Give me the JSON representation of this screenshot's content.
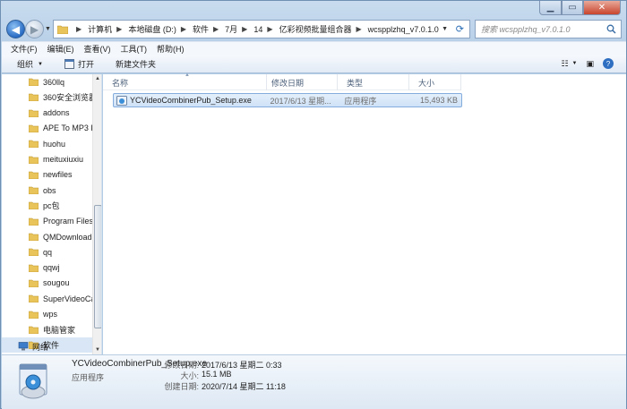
{
  "window": {
    "caption_buttons": {
      "minimize": "▁",
      "maximize": "▭",
      "close": "✕"
    }
  },
  "address_bar": {
    "breadcrumbs": [
      "计算机",
      "本地磁盘 (D:)",
      "软件",
      "7月",
      "14",
      "亿彩视频批量组合器",
      "wcspplzhq_v7.0.1.0"
    ],
    "search_placeholder": "搜索 wcspplzhq_v7.0.1.0"
  },
  "menubar": {
    "items": [
      "文件(F)",
      "编辑(E)",
      "查看(V)",
      "工具(T)",
      "帮助(H)"
    ]
  },
  "toolbar": {
    "organize": "组织",
    "open": "打开",
    "new_folder": "新建文件夹"
  },
  "nav_tree": {
    "items": [
      {
        "label": "360llq",
        "selected": false
      },
      {
        "label": "360安全浏览器",
        "selected": false
      },
      {
        "label": "addons",
        "selected": false
      },
      {
        "label": "APE To MP3 F",
        "selected": false
      },
      {
        "label": "huohu",
        "selected": false
      },
      {
        "label": "meituxiuxiu",
        "selected": false
      },
      {
        "label": "newfiles",
        "selected": false
      },
      {
        "label": "obs",
        "selected": false
      },
      {
        "label": "pc包",
        "selected": false
      },
      {
        "label": "Program Files",
        "selected": false
      },
      {
        "label": "QMDownload",
        "selected": false
      },
      {
        "label": "qq",
        "selected": false
      },
      {
        "label": "qqwj",
        "selected": false
      },
      {
        "label": "sougou",
        "selected": false
      },
      {
        "label": "SuperVideoCa",
        "selected": false
      },
      {
        "label": "wps",
        "selected": false
      },
      {
        "label": "电脑管家",
        "selected": false
      },
      {
        "label": "软件",
        "selected": true
      }
    ],
    "network": "网络"
  },
  "file_list": {
    "columns": {
      "name": "名称",
      "date": "修改日期",
      "type": "类型",
      "size": "大小"
    },
    "rows": [
      {
        "name": "YCVideoCombinerPub_Setup.exe",
        "date": "2017/6/13 星期...",
        "type": "应用程序",
        "size": "15,493 KB"
      }
    ]
  },
  "details_pane": {
    "name": "YCVideoCombinerPub_Setup.exe",
    "type": "应用程序",
    "modified_label": "修改日期:",
    "modified_value": "2017/6/13 星期二 0:33",
    "size_label": "大小:",
    "size_value": "15.1 MB",
    "created_label": "创建日期:",
    "created_value": "2020/7/14 星期二 11:18"
  },
  "colors": {
    "folder": "#e9c45a",
    "selection": "#cfe2f7",
    "chrome": "#b4cde6"
  }
}
